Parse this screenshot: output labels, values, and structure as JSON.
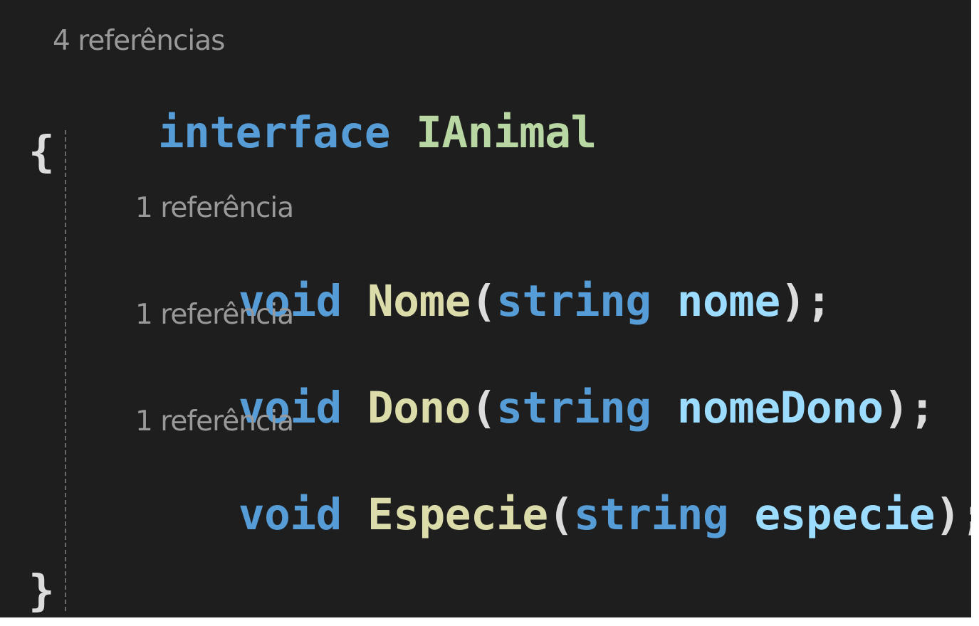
{
  "interface_block": {
    "codelens": "4 referências",
    "keyword": "interface",
    "name": "IAnimal",
    "open_brace": "{",
    "close_brace": "}"
  },
  "members": [
    {
      "codelens": "1 referência",
      "return_type": "void",
      "method": "Nome",
      "open_paren": "(",
      "param_type": "string",
      "param_name": "nome",
      "terminator": ");"
    },
    {
      "codelens": "1 referência",
      "return_type": "void",
      "method": "Dono",
      "open_paren": "(",
      "param_type": "string",
      "param_name": "nomeDono",
      "terminator": ");"
    },
    {
      "codelens": "1 referência",
      "return_type": "void",
      "method": "Especie",
      "open_paren": "(",
      "param_type": "string",
      "param_name": "especie",
      "terminator": ");"
    }
  ],
  "colors": {
    "background": "#1e1e1e",
    "keyword": "#569cd6",
    "type_name": "#b8d7a3",
    "method_name": "#dcdcaa",
    "parameter": "#9cdcfe",
    "punctuation": "#dcdcdc",
    "codelens": "#999999"
  }
}
